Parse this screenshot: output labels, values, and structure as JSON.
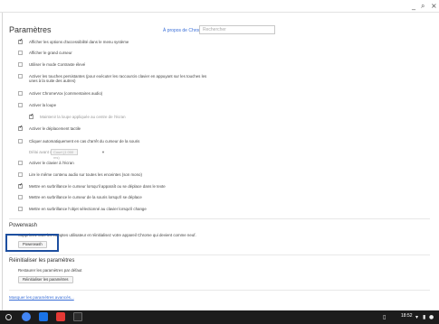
{
  "window": {
    "minimize": "_",
    "search_icon_glyph": "⌕",
    "close": "×"
  },
  "header": {
    "title": "Paramètres",
    "about_link": "À propos de Chrome OS",
    "search_placeholder": "Rechercher"
  },
  "accessibility": {
    "options": [
      {
        "label": "Afficher les options d'accessibilité dans le menu système",
        "checked": true
      },
      {
        "label": "Afficher le grand curseur",
        "checked": false
      },
      {
        "label": "Utiliser le mode Contraste élevé",
        "checked": false
      },
      {
        "label": "Activer les touches persistantes (pour exécuter les raccourcis clavier en appuyant sur les touches les unes à la suite des autres)",
        "checked": false
      },
      {
        "label": "Activer ChromeVox (commentaires audio)",
        "checked": false
      },
      {
        "label": "Activer la loupe",
        "checked": false
      },
      {
        "label": "Maintenir la loupe appliquée au centre de l'écran",
        "checked": true
      },
      {
        "label": "Activer le déplacement tactile",
        "checked": true
      },
      {
        "label": "Cliquer automatiquement en cas d'arrêt du curseur de la souris",
        "checked": false
      },
      {
        "label": "Activer le clavier à l'écran",
        "checked": false
      },
      {
        "label": "Lire le même contenu audio sur toutes les enceintes (son mono)",
        "checked": false
      },
      {
        "label": "Mettre en surbrillance le curseur lorsqu'il apparaît ou se déplace dans le texte",
        "checked": true
      },
      {
        "label": "Mettre en surbrillance le curseur de la souris lorsqu'il se déplace",
        "checked": false
      },
      {
        "label": "Mettre en surbrillance l'objet sélectionné au clavier lorsqu'il change",
        "checked": false
      }
    ],
    "delay_label": "Délai avant un clic :",
    "delay_value": "Court (1 000 ms)"
  },
  "powerwash": {
    "title": "Powerwash",
    "description": "Supprimez tous les comptes utilisateur et réinitialisez votre appareil Chrome qui devient comme neuf.",
    "button": "Powerwash"
  },
  "reset": {
    "title": "Réinitialiser les paramètres",
    "description": "Restaurer les paramètres par défaut",
    "button": "Réinitialiser les paramètres"
  },
  "advanced_link": "Masquer les paramètres avancés...",
  "shelf": {
    "time": "18:52",
    "apps": [
      "chrome-icon",
      "files-icon",
      "youtube-icon",
      "play-store-icon"
    ]
  }
}
